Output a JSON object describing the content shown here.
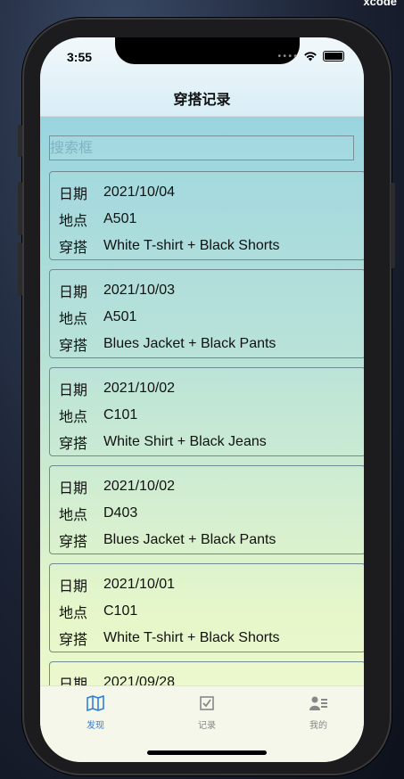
{
  "window": {
    "title": "xcode"
  },
  "status_bar": {
    "time": "3:55"
  },
  "nav": {
    "title": "穿搭记录"
  },
  "search": {
    "placeholder": "搜索框"
  },
  "labels": {
    "date": "日期",
    "place": "地点",
    "outfit": "穿搭"
  },
  "records": [
    {
      "date": "2021/10/04",
      "place": "A501",
      "outfit": "White T-shirt + Black Shorts"
    },
    {
      "date": "2021/10/03",
      "place": "A501",
      "outfit": "Blues Jacket + Black Pants"
    },
    {
      "date": "2021/10/02",
      "place": "C101",
      "outfit": "White Shirt + Black Jeans"
    },
    {
      "date": "2021/10/02",
      "place": "D403",
      "outfit": "Blues Jacket + Black Pants"
    },
    {
      "date": "2021/10/01",
      "place": "C101",
      "outfit": "White T-shirt + Black Shorts"
    },
    {
      "date": "2021/09/28",
      "place": "",
      "outfit": ""
    }
  ],
  "tabs": [
    {
      "label": "发现",
      "icon": "map-icon",
      "active": true
    },
    {
      "label": "记录",
      "icon": "checklist-icon",
      "active": false
    },
    {
      "label": "我的",
      "icon": "profile-icon",
      "active": false
    }
  ],
  "colors": {
    "accent": "#2f80d8",
    "tab_inactive": "#888888"
  }
}
